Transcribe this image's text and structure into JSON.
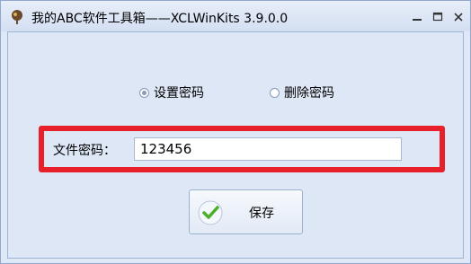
{
  "window": {
    "title": "我的ABC软件工具箱——XCLWinKits 3.9.0.0"
  },
  "options": [
    {
      "label": "设置密码",
      "checked": true
    },
    {
      "label": "删除密码",
      "checked": false
    }
  ],
  "form": {
    "file_password_label": "文件密码：",
    "file_password_value": "123456"
  },
  "actions": {
    "save_label": "保存"
  },
  "colors": {
    "highlight": "#e8202a",
    "background": "#dde7f5",
    "check_green": "#4caf2a"
  }
}
